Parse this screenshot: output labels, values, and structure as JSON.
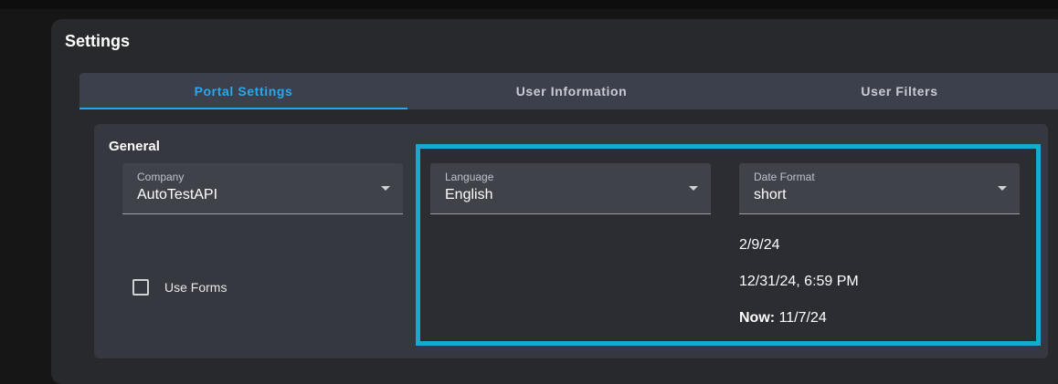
{
  "page": {
    "title": "Settings"
  },
  "tabs": [
    {
      "label": "Portal Settings",
      "active": true
    },
    {
      "label": "User Information",
      "active": false
    },
    {
      "label": "User Filters",
      "active": false
    }
  ],
  "general": {
    "title": "General",
    "company": {
      "label": "Company",
      "value": "AutoTestAPI"
    },
    "language": {
      "label": "Language",
      "value": "English"
    },
    "date_format": {
      "label": "Date Format",
      "value": "short"
    },
    "use_forms": {
      "label": "Use Forms",
      "checked": false
    },
    "date_examples": {
      "example1": "2/9/24",
      "example2": "12/31/24, 6:59 PM",
      "now_label": "Now:",
      "now_value": "11/7/24"
    }
  },
  "colors": {
    "accent": "#2aa7ec",
    "highlight_border": "#19a8cf",
    "panel_bg": "#28292c",
    "card_bg": "#363840",
    "tab_bar_bg": "#3b404c"
  },
  "icons": {
    "dropdown": "chevron-down-icon",
    "checkbox": "checkbox-unchecked-icon"
  }
}
